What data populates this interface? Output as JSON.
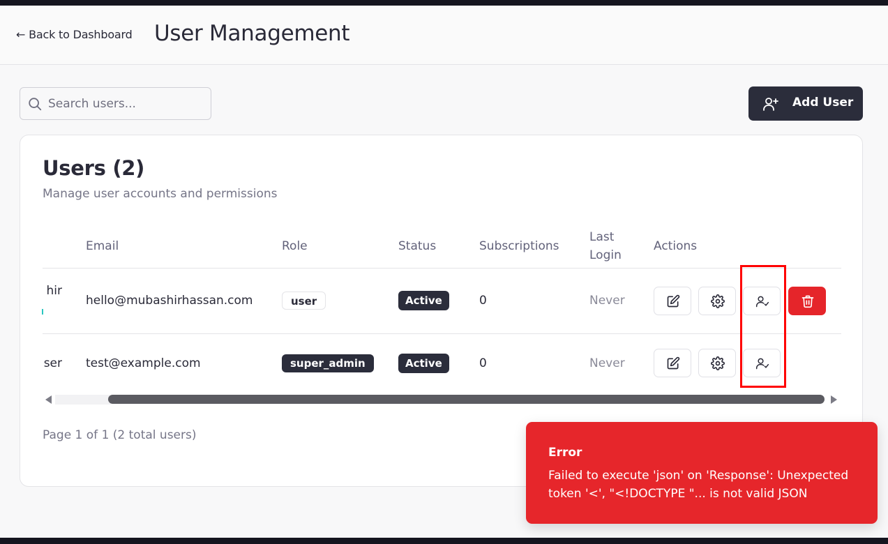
{
  "header": {
    "back_label": "← Back to Dashboard",
    "title": "User Management"
  },
  "search": {
    "placeholder": "Search users...",
    "value": ""
  },
  "toolbar": {
    "add_user_label": "Add User"
  },
  "users_card": {
    "title": "Users (2)",
    "subtitle": "Manage user accounts and permissions",
    "columns": {
      "email": "Email",
      "role": "Role",
      "status": "Status",
      "subscriptions": "Subscriptions",
      "last_login_line1": "Last",
      "last_login_line2": "Login",
      "actions": "Actions"
    },
    "rows": [
      {
        "name_fragment": "hir",
        "email": "hello@mubashirhassan.com",
        "role": "user",
        "status": "Active",
        "subscriptions": "0",
        "last_login": "Never",
        "actions": [
          "edit-icon",
          "gear-icon",
          "user-check-icon",
          "trash-icon"
        ]
      },
      {
        "name_fragment": "ser",
        "email": "test@example.com",
        "role": "super_admin",
        "status": "Active",
        "subscriptions": "0",
        "last_login": "Never",
        "actions": [
          "edit-icon",
          "gear-icon",
          "user-check-icon"
        ]
      }
    ],
    "pagination": "Page 1 of 1 (2 total users)"
  },
  "toast": {
    "title": "Error",
    "message": "Failed to execute 'json' on 'Response': Unexpected token '<', \"<!DOCTYPE \"... is not valid JSON"
  },
  "colors": {
    "primary": "#2b2d3b",
    "danger": "#e5252a",
    "highlight": "#ff0000",
    "background": "#f8f8f9"
  }
}
